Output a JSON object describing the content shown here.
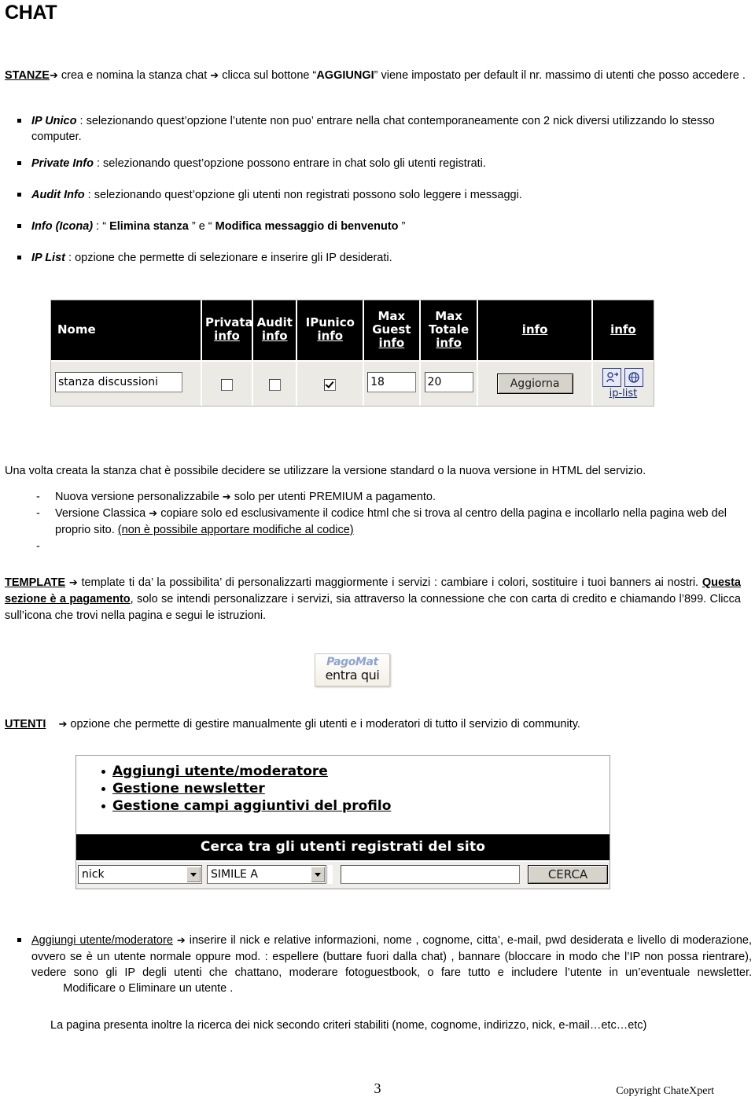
{
  "document": {
    "title": "CHAT"
  },
  "intro": {
    "term": "STANZE",
    "arrow": "➔",
    "text_before_btn": "crea e nomina la stanza chat",
    "arrow2": "➔",
    "text_mid": "clicca sul bottone “",
    "button_name": "AGGIUNGI",
    "text_after": "” viene impostato per default il nr. massimo di utenti che posso accedere ."
  },
  "options": [
    {
      "term": "IP Unico",
      "text": " : selezionando quest’opzione l’utente non puo’ entrare nella chat contemporaneamente con 2 nick diversi utilizzando lo stesso computer."
    },
    {
      "term": "Private Info",
      "text": "  : selezionando quest’opzione possono entrare in chat solo gli utenti registrati."
    },
    {
      "term": "Audit Info",
      "text": " : selezionando quest’opzione gli utenti non registrati  possono solo leggere i messaggi."
    },
    {
      "term": "Info (Icona)",
      "text_plain": " : “ ",
      "bold1": "Elimina stanza",
      "text_mid": " ” e “ ",
      "bold2": "Modifica messaggio di benvenuto",
      "text_end": " ”"
    },
    {
      "term": "IP List",
      "text": " : opzione che permette di selezionare e inserire  gli IP desiderati."
    }
  ],
  "rooms_screenshot": {
    "columns": [
      {
        "label": "Nome",
        "info": ""
      },
      {
        "label": "Privata",
        "info": "info"
      },
      {
        "label": "Audit",
        "info": "info"
      },
      {
        "label": "IPunico",
        "info": "info"
      },
      {
        "label": "Max Guest",
        "info": "info"
      },
      {
        "label": "Max Totale",
        "info": "info"
      },
      {
        "label": "",
        "info": "info"
      },
      {
        "label": "",
        "info": "info"
      }
    ],
    "header_max_guest_line1": "Max",
    "header_max_guest_line2": "Guest",
    "header_max_totale_line1": "Max",
    "header_max_totale_line2": "Totale",
    "row": {
      "nome_value": "stanza discussioni",
      "privata_checked": "unchecked",
      "audit_checked": "unchecked",
      "ipunico_checked": "checked",
      "max_guest_value": "18",
      "max_totale_value": "20",
      "update_button": "Aggiorna",
      "iplist_label": "ip-list"
    }
  },
  "versions": {
    "intro": "Una volta creata la stanza chat  è possibile decidere se utilizzare la versione standard o la nuova versione in HTML del servizio.",
    "items": [
      {
        "dash": "-",
        "text": "Nuova versione personalizzabile",
        "arrow": "➔",
        "text2": " solo per utenti PREMIUM a pagamento."
      },
      {
        "dash": "-",
        "text": "Versione Classica",
        "arrow": "➔",
        "text2": " copiare solo ed esclusivamente il codice html  che si trova al centro della pagina e incollarlo nella pagina web del proprio sito.  ",
        "underlined": "(non è possibile apportare modifiche al codice)"
      },
      {
        "dash": "-",
        "text": "",
        "arrow": "",
        "text2": ""
      }
    ]
  },
  "template_section": {
    "term": "TEMPLATE",
    "arrow": "➔",
    "text1": " template ti da’ la possibilita’ di personalizzarti maggiormente i servizi : cambiare i colori, sostituire i tuoi banners ai nostri.  ",
    "underlined_bold": "Questa sezione è a pagamento",
    "text2": ", solo se intendi personalizzare i servizi, sia attraverso la connessione che con carta di credito e chiamando l’899.  Clicca sull’icona che trovi  nella pagina e segui le istruzioni."
  },
  "pagomat": {
    "brand": "PagoMat",
    "action": "entra qui"
  },
  "utenti_section": {
    "term": "UTENTI",
    "arrow": "➔",
    "text": " opzione che permette di gestire manualmente gli utenti e i moderatori di tutto il servizio di community."
  },
  "users_screenshot": {
    "links": [
      "Aggiungi utente/moderatore",
      "Gestione newsletter",
      "Gestione campi aggiuntivi del profilo"
    ],
    "search_bar_title": "Cerca tra gli utenti registrati del sito",
    "field_select_value": "nick",
    "operator_select_value": "SIMILE A",
    "query_value": "",
    "query_placeholder": "",
    "search_button": "CERCA"
  },
  "add_user_note": {
    "underlined_term": "Aggiungi utente/moderatore",
    "arrow": "➔",
    "text": " inserire il nick e relative informazioni, nome , cognome, citta’, e-mail, pwd desiderata e livello di moderazione, ovvero se è un utente normale oppure mod. : espellere (buttare fuori dalla chat) , bannare (bloccare in modo che l’IP non possa rientrare), vedere sono gli IP degli utenti che chattano, moderare fotoguestbook, o fare tutto e includere l’utente in un’eventuale newsletter.",
    "tail": "          Modificare o Eliminare un utente ."
  },
  "closing_note": "La pagina presenta inoltre la ricerca dei nick secondo criteri stabiliti (nome, cognome, indirizzo, nick, e-mail…etc…etc)",
  "footer": {
    "page_number": "3",
    "copyright": "Copyright ChateXpert"
  },
  "colors": {
    "header_black": "#000000",
    "ip_icon_blue": "#2f3f8f",
    "pagomat_brand": "#8da4cc",
    "win_face": "#d6d3cb"
  }
}
